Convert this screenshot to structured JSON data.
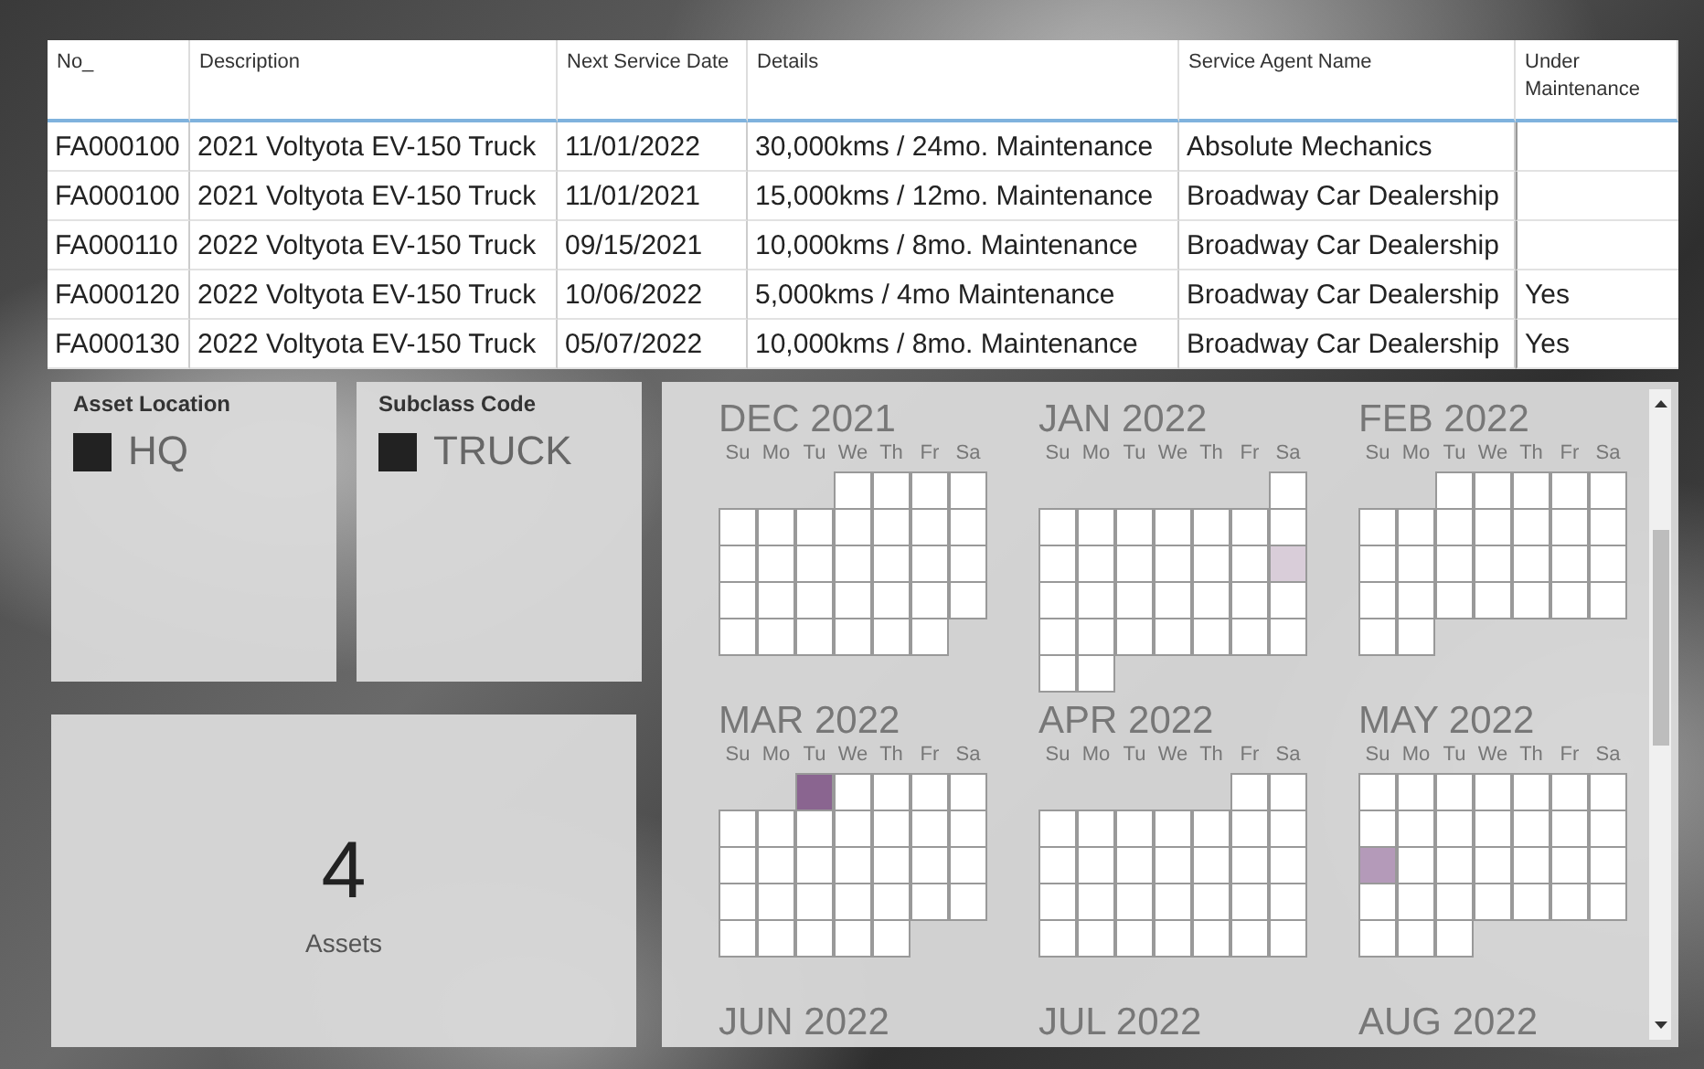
{
  "table": {
    "columns": [
      "No_",
      "Description",
      "Next Service Date",
      "Details",
      "Service Agent Name",
      "Under Maintenance"
    ],
    "rows": [
      {
        "no": "FA000100",
        "description": "2021 Voltyota EV-150 Truck",
        "next_service_date": "11/01/2022",
        "details": "30,000kms / 24mo. Maintenance",
        "agent": "Absolute Mechanics"
      },
      {
        "no": "FA000100",
        "description": "2021 Voltyota EV-150 Truck",
        "next_service_date": "11/01/2021",
        "details": "15,000kms / 12mo. Maintenance",
        "agent": "Broadway Car Dealership"
      },
      {
        "no": "FA000110",
        "description": "2022 Voltyota EV-150 Truck",
        "next_service_date": "09/15/2021",
        "details": "10,000kms / 8mo. Maintenance",
        "agent": "Broadway Car Dealership"
      },
      {
        "no": "FA000120",
        "description": "2022 Voltyota EV-150 Truck",
        "next_service_date": "10/06/2022",
        "details": "5,000kms / 4mo Maintenance",
        "agent": "Broadway Car Dealership",
        "under_maintenance": "Yes"
      },
      {
        "no": "FA000130",
        "description": "2022 Voltyota EV-150 Truck",
        "next_service_date": "05/07/2022",
        "details": "10,000kms / 8mo. Maintenance",
        "agent": "Broadway Car Dealership",
        "under_maintenance": "Yes"
      }
    ]
  },
  "slicers": [
    {
      "title": "Asset Location",
      "value": "HQ",
      "checked": true
    },
    {
      "title": "Subclass Code",
      "value": "TRUCK",
      "checked": true
    }
  ],
  "kpi": {
    "value": "4",
    "label": "Assets"
  },
  "calendar": {
    "months": [
      {
        "title": "DEC 2021",
        "weekdays": [
          "Su",
          "Mo",
          "Tu",
          "We",
          "Th",
          "Fr",
          "Sa"
        ],
        "weeks": [
          {
            "kind": "first",
            "days": [
              {
                "color": "#ffffff"
              },
              {
                "color": "#ffffff"
              },
              {
                "color": "#ffffff"
              },
              {
                "color": "#ffffff"
              }
            ]
          },
          {
            "kind": "full",
            "days": [
              {
                "color": "#ffffff"
              },
              {
                "color": "#ffffff"
              },
              {
                "color": "#ffffff"
              },
              {
                "color": "#ffffff"
              },
              {
                "color": "#ffffff"
              },
              {
                "color": "#ffffff"
              },
              {
                "color": "#ffffff"
              }
            ]
          },
          {
            "kind": "full",
            "days": [
              {
                "color": "#ffffff"
              },
              {
                "color": "#ffffff"
              },
              {
                "color": "#ffffff"
              },
              {
                "color": "#ffffff"
              },
              {
                "color": "#ffffff"
              },
              {
                "color": "#ffffff"
              },
              {
                "color": "#ffffff"
              }
            ]
          },
          {
            "kind": "full",
            "days": [
              {
                "color": "#ffffff"
              },
              {
                "color": "#ffffff"
              },
              {
                "color": "#ffffff"
              },
              {
                "color": "#ffffff"
              },
              {
                "color": "#ffffff"
              },
              {
                "color": "#ffffff"
              },
              {
                "color": "#ffffff"
              }
            ]
          },
          {
            "kind": "last",
            "days": [
              {
                "color": "#ffffff"
              },
              {
                "color": "#ffffff"
              },
              {
                "color": "#ffffff"
              },
              {
                "color": "#ffffff"
              },
              {
                "color": "#ffffff"
              },
              {
                "color": "#ffffff"
              }
            ]
          }
        ]
      },
      {
        "title": "JAN 2022",
        "weekdays": [
          "Su",
          "Mo",
          "Tu",
          "We",
          "Th",
          "Fr",
          "Sa"
        ],
        "weeks": [
          {
            "kind": "first",
            "days": [
              {
                "color": "#ffffff"
              }
            ]
          },
          {
            "kind": "full",
            "days": [
              {
                "color": "#ffffff"
              },
              {
                "color": "#ffffff"
              },
              {
                "color": "#ffffff"
              },
              {
                "color": "#ffffff"
              },
              {
                "color": "#ffffff"
              },
              {
                "color": "#ffffff"
              },
              {
                "color": "#ffffff"
              }
            ]
          },
          {
            "kind": "full",
            "days": [
              {
                "color": "#ffffff"
              },
              {
                "color": "#ffffff"
              },
              {
                "color": "#ffffff"
              },
              {
                "color": "#ffffff"
              },
              {
                "color": "#ffffff"
              },
              {
                "color": "#ffffff"
              },
              {
                "color": "#d9cdd9"
              }
            ]
          },
          {
            "kind": "full",
            "days": [
              {
                "color": "#ffffff"
              },
              {
                "color": "#ffffff"
              },
              {
                "color": "#ffffff"
              },
              {
                "color": "#ffffff"
              },
              {
                "color": "#ffffff"
              },
              {
                "color": "#ffffff"
              },
              {
                "color": "#ffffff"
              }
            ]
          },
          {
            "kind": "full",
            "days": [
              {
                "color": "#ffffff"
              },
              {
                "color": "#ffffff"
              },
              {
                "color": "#ffffff"
              },
              {
                "color": "#ffffff"
              },
              {
                "color": "#ffffff"
              },
              {
                "color": "#ffffff"
              },
              {
                "color": "#ffffff"
              }
            ]
          },
          {
            "kind": "last",
            "days": [
              {
                "color": "#ffffff"
              },
              {
                "color": "#ffffff"
              }
            ]
          }
        ]
      },
      {
        "title": "FEB 2022",
        "weekdays": [
          "Su",
          "Mo",
          "Tu",
          "We",
          "Th",
          "Fr",
          "Sa"
        ],
        "weeks": [
          {
            "kind": "first",
            "days": [
              {
                "color": "#ffffff"
              },
              {
                "color": "#ffffff"
              },
              {
                "color": "#ffffff"
              },
              {
                "color": "#ffffff"
              },
              {
                "color": "#ffffff"
              }
            ]
          },
          {
            "kind": "full",
            "days": [
              {
                "color": "#ffffff"
              },
              {
                "color": "#ffffff"
              },
              {
                "color": "#ffffff"
              },
              {
                "color": "#ffffff"
              },
              {
                "color": "#ffffff"
              },
              {
                "color": "#ffffff"
              },
              {
                "color": "#ffffff"
              }
            ]
          },
          {
            "kind": "full",
            "days": [
              {
                "color": "#ffffff"
              },
              {
                "color": "#ffffff"
              },
              {
                "color": "#ffffff"
              },
              {
                "color": "#ffffff"
              },
              {
                "color": "#ffffff"
              },
              {
                "color": "#ffffff"
              },
              {
                "color": "#ffffff"
              }
            ]
          },
          {
            "kind": "full",
            "days": [
              {
                "color": "#ffffff"
              },
              {
                "color": "#ffffff"
              },
              {
                "color": "#ffffff"
              },
              {
                "color": "#ffffff"
              },
              {
                "color": "#ffffff"
              },
              {
                "color": "#ffffff"
              },
              {
                "color": "#ffffff"
              }
            ]
          },
          {
            "kind": "last",
            "days": [
              {
                "color": "#ffffff"
              },
              {
                "color": "#ffffff"
              }
            ]
          }
        ]
      },
      {
        "title": "MAR 2022",
        "weekdays": [
          "Su",
          "Mo",
          "Tu",
          "We",
          "Th",
          "Fr",
          "Sa"
        ],
        "weeks": [
          {
            "kind": "first",
            "days": [
              {
                "color": "#8a6590"
              },
              {
                "color": "#ffffff"
              },
              {
                "color": "#ffffff"
              },
              {
                "color": "#ffffff"
              },
              {
                "color": "#ffffff"
              }
            ]
          },
          {
            "kind": "full",
            "days": [
              {
                "color": "#ffffff"
              },
              {
                "color": "#ffffff"
              },
              {
                "color": "#ffffff"
              },
              {
                "color": "#ffffff"
              },
              {
                "color": "#ffffff"
              },
              {
                "color": "#ffffff"
              },
              {
                "color": "#ffffff"
              }
            ]
          },
          {
            "kind": "full",
            "days": [
              {
                "color": "#ffffff"
              },
              {
                "color": "#ffffff"
              },
              {
                "color": "#ffffff"
              },
              {
                "color": "#ffffff"
              },
              {
                "color": "#ffffff"
              },
              {
                "color": "#ffffff"
              },
              {
                "color": "#ffffff"
              }
            ]
          },
          {
            "kind": "full",
            "days": [
              {
                "color": "#ffffff"
              },
              {
                "color": "#ffffff"
              },
              {
                "color": "#ffffff"
              },
              {
                "color": "#ffffff"
              },
              {
                "color": "#ffffff"
              },
              {
                "color": "#ffffff"
              },
              {
                "color": "#ffffff"
              }
            ]
          },
          {
            "kind": "last",
            "days": [
              {
                "color": "#ffffff"
              },
              {
                "color": "#ffffff"
              },
              {
                "color": "#ffffff"
              },
              {
                "color": "#ffffff"
              },
              {
                "color": "#ffffff"
              }
            ]
          }
        ]
      },
      {
        "title": "APR 2022",
        "weekdays": [
          "Su",
          "Mo",
          "Tu",
          "We",
          "Th",
          "Fr",
          "Sa"
        ],
        "weeks": [
          {
            "kind": "first",
            "days": [
              {
                "color": "#ffffff"
              },
              {
                "color": "#ffffff"
              }
            ]
          },
          {
            "kind": "full",
            "days": [
              {
                "color": "#ffffff"
              },
              {
                "color": "#ffffff"
              },
              {
                "color": "#ffffff"
              },
              {
                "color": "#ffffff"
              },
              {
                "color": "#ffffff"
              },
              {
                "color": "#ffffff"
              },
              {
                "color": "#ffffff"
              }
            ]
          },
          {
            "kind": "full",
            "days": [
              {
                "color": "#ffffff"
              },
              {
                "color": "#ffffff"
              },
              {
                "color": "#ffffff"
              },
              {
                "color": "#ffffff"
              },
              {
                "color": "#ffffff"
              },
              {
                "color": "#ffffff"
              },
              {
                "color": "#ffffff"
              }
            ]
          },
          {
            "kind": "full",
            "days": [
              {
                "color": "#ffffff"
              },
              {
                "color": "#ffffff"
              },
              {
                "color": "#ffffff"
              },
              {
                "color": "#ffffff"
              },
              {
                "color": "#ffffff"
              },
              {
                "color": "#ffffff"
              },
              {
                "color": "#ffffff"
              }
            ]
          },
          {
            "kind": "full",
            "days": [
              {
                "color": "#ffffff"
              },
              {
                "color": "#ffffff"
              },
              {
                "color": "#ffffff"
              },
              {
                "color": "#ffffff"
              },
              {
                "color": "#ffffff"
              },
              {
                "color": "#ffffff"
              },
              {
                "color": "#ffffff"
              }
            ]
          }
        ]
      },
      {
        "title": "MAY 2022",
        "weekdays": [
          "Su",
          "Mo",
          "Tu",
          "We",
          "Th",
          "Fr",
          "Sa"
        ],
        "weeks": [
          {
            "kind": "full",
            "days": [
              {
                "color": "#ffffff"
              },
              {
                "color": "#ffffff"
              },
              {
                "color": "#ffffff"
              },
              {
                "color": "#ffffff"
              },
              {
                "color": "#ffffff"
              },
              {
                "color": "#ffffff"
              },
              {
                "color": "#ffffff"
              }
            ]
          },
          {
            "kind": "full",
            "days": [
              {
                "color": "#ffffff"
              },
              {
                "color": "#ffffff"
              },
              {
                "color": "#ffffff"
              },
              {
                "color": "#ffffff"
              },
              {
                "color": "#ffffff"
              },
              {
                "color": "#ffffff"
              },
              {
                "color": "#ffffff"
              }
            ]
          },
          {
            "kind": "full",
            "days": [
              {
                "color": "#b49ab9"
              },
              {
                "color": "#ffffff"
              },
              {
                "color": "#ffffff"
              },
              {
                "color": "#ffffff"
              },
              {
                "color": "#ffffff"
              },
              {
                "color": "#ffffff"
              },
              {
                "color": "#ffffff"
              }
            ]
          },
          {
            "kind": "full",
            "days": [
              {
                "color": "#ffffff"
              },
              {
                "color": "#ffffff"
              },
              {
                "color": "#ffffff"
              },
              {
                "color": "#ffffff"
              },
              {
                "color": "#ffffff"
              },
              {
                "color": "#ffffff"
              },
              {
                "color": "#ffffff"
              }
            ]
          },
          {
            "kind": "last",
            "days": [
              {
                "color": "#ffffff"
              },
              {
                "color": "#ffffff"
              },
              {
                "color": "#ffffff"
              }
            ]
          }
        ]
      },
      {
        "title": "JUN 2022"
      },
      {
        "title": "JUL 2022"
      },
      {
        "title": "AUG 2022"
      }
    ]
  }
}
